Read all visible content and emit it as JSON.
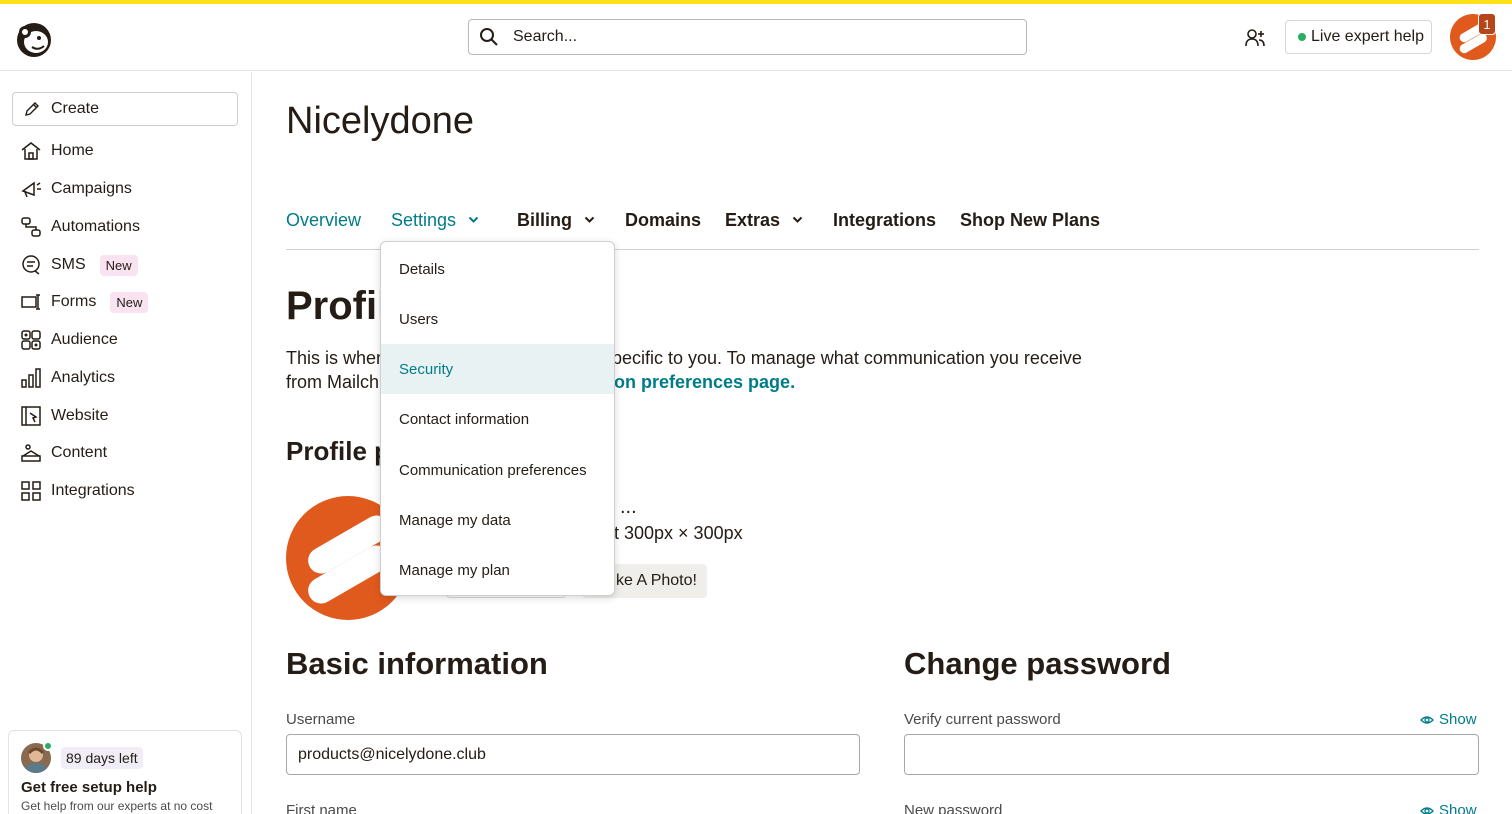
{
  "header": {
    "search_placeholder": "Search...",
    "live_help_label": "Live expert help",
    "notification_count": "1"
  },
  "sidebar": {
    "create_label": "Create",
    "items": [
      {
        "label": "Home",
        "icon": "home-icon"
      },
      {
        "label": "Campaigns",
        "icon": "megaphone-icon"
      },
      {
        "label": "Automations",
        "icon": "automation-icon"
      },
      {
        "label": "SMS",
        "icon": "sms-icon",
        "badge": "New"
      },
      {
        "label": "Forms",
        "icon": "form-icon",
        "badge": "New"
      },
      {
        "label": "Audience",
        "icon": "audience-icon"
      },
      {
        "label": "Analytics",
        "icon": "bar-chart-icon"
      },
      {
        "label": "Website",
        "icon": "website-icon"
      },
      {
        "label": "Content",
        "icon": "content-icon"
      },
      {
        "label": "Integrations",
        "icon": "grid-icon"
      }
    ],
    "trial": {
      "days_left": "89 days left",
      "title": "Get free setup help",
      "subtitle": "Get help from our experts at no cost"
    }
  },
  "main": {
    "org_title": "Nicelydone",
    "tabs": [
      {
        "label": "Overview"
      },
      {
        "label": "Settings"
      },
      {
        "label": "Billing"
      },
      {
        "label": "Domains"
      },
      {
        "label": "Extras"
      },
      {
        "label": "Integrations"
      },
      {
        "label": "Shop New Plans"
      }
    ],
    "page_heading_visible": "Profil",
    "intro_line1_start": "This is wher",
    "intro_line1_end": "pecific to you. To manage what communication you receive",
    "intro_line2_start": "from Mailch",
    "intro_link": "on preferences page.",
    "profile_photo_heading_visible": "Profile p",
    "upload_dots": "...",
    "upload_size": "t 300px × 300px",
    "photo_button": "ke A Photo!",
    "basic_info": {
      "title": "Basic information",
      "username_label": "Username",
      "username_value": "products@nicelydone.club",
      "first_name_label": "First name"
    },
    "change_password": {
      "title": "Change password",
      "verify_label": "Verify current password",
      "new_label": "New password",
      "show_label": "Show"
    }
  },
  "dropdown": {
    "items": [
      {
        "label": "Details"
      },
      {
        "label": "Users"
      },
      {
        "label": "Security",
        "active": true
      },
      {
        "label": "Contact information"
      },
      {
        "label": "Communication preferences"
      },
      {
        "label": "Manage my data"
      },
      {
        "label": "Manage my plan"
      }
    ]
  },
  "colors": {
    "accent": "#007c89",
    "brand_yellow": "#ffe01b",
    "avatar_orange": "#e05a1e",
    "badge_pink": "#f9e3f0"
  }
}
